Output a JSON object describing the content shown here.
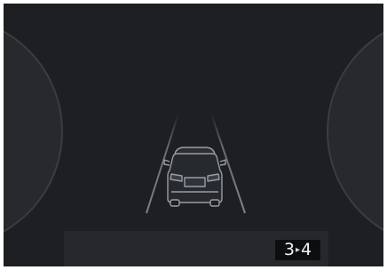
{
  "display": {
    "background": "#1d1f22",
    "gauge_color": "#27292d",
    "lane_color": "#8a8e95",
    "car_icon": "car-rear-icon",
    "gear_shift": {
      "current": "3",
      "next": "4",
      "arrow": "▸",
      "icon": "shift-arrow-icon"
    }
  }
}
